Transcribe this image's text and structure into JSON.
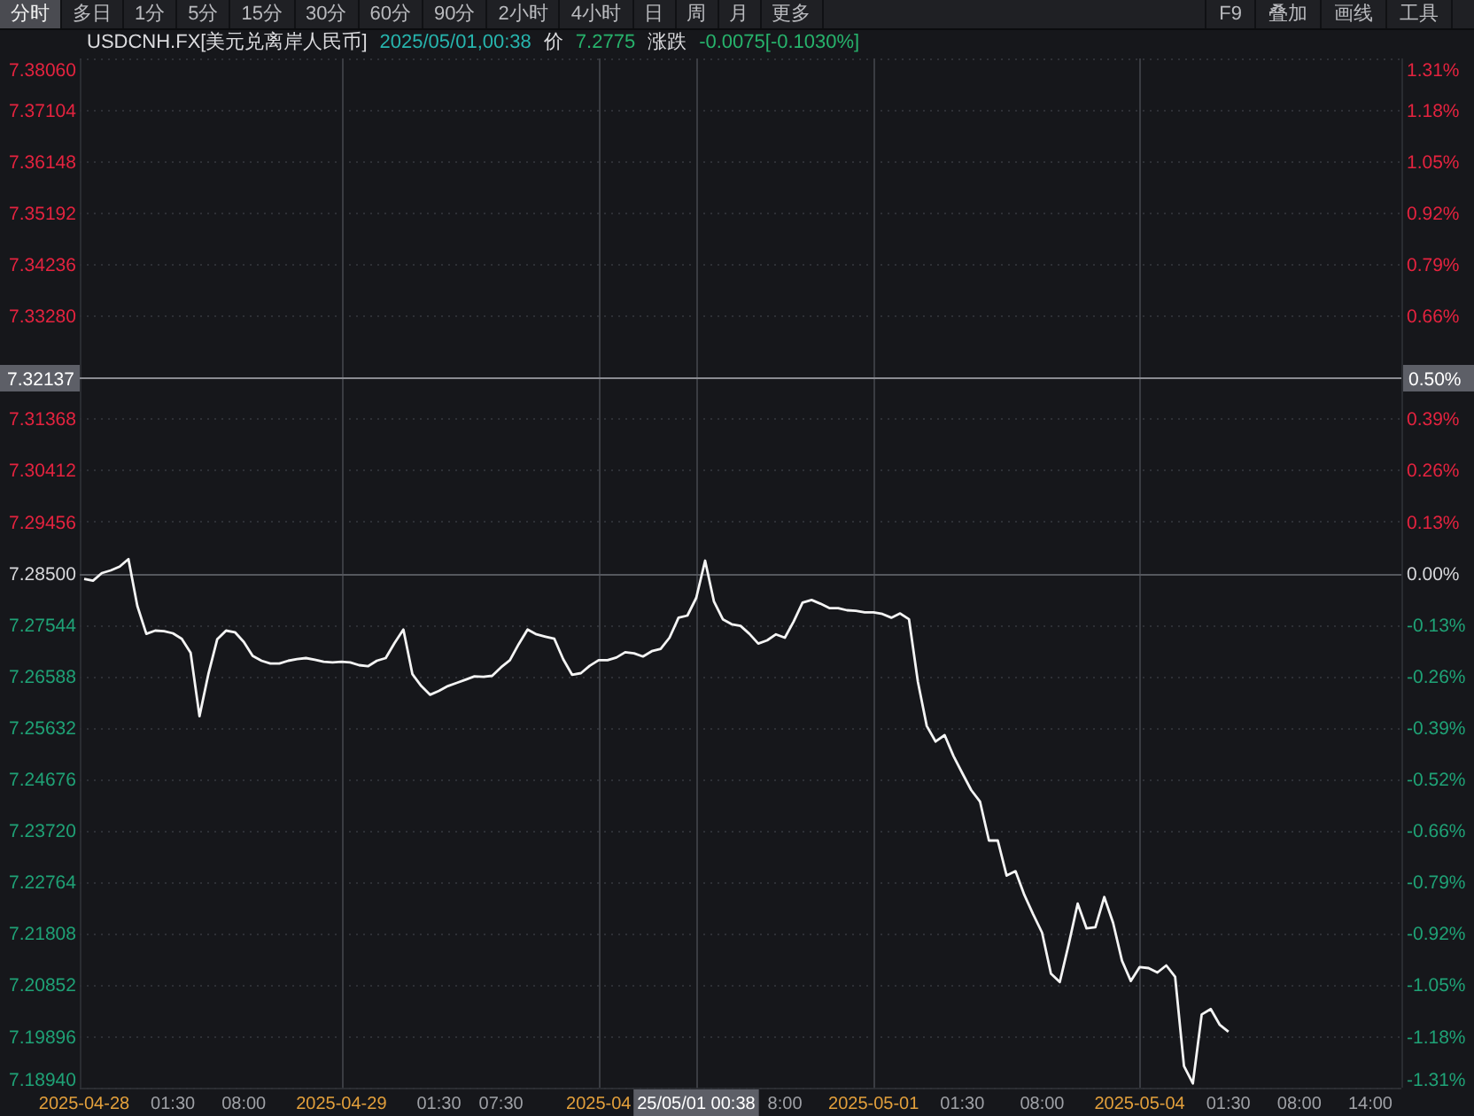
{
  "toolbar": {
    "tabs": [
      {
        "label": "分时",
        "selected": true
      },
      {
        "label": "多日",
        "selected": false
      },
      {
        "label": "1分",
        "selected": false
      },
      {
        "label": "5分",
        "selected": false
      },
      {
        "label": "15分",
        "selected": false
      },
      {
        "label": "30分",
        "selected": false
      },
      {
        "label": "60分",
        "selected": false
      },
      {
        "label": "90分",
        "selected": false
      },
      {
        "label": "2小时",
        "selected": false
      },
      {
        "label": "4小时",
        "selected": false
      },
      {
        "label": "日",
        "selected": false
      },
      {
        "label": "周",
        "selected": false
      },
      {
        "label": "月",
        "selected": false
      },
      {
        "label": "更多",
        "selected": false
      }
    ],
    "actions": [
      "F9",
      "叠加",
      "画线",
      "工具"
    ]
  },
  "quote": {
    "symbol": "USDCNH.FX[美元兑离岸人民币]",
    "time": "2025/05/01,00:38",
    "price_caption": "价",
    "price": "7.2775",
    "change_caption": "涨跌",
    "change": "-0.0075[-0.1030%]",
    "down": true
  },
  "chart": {
    "chart_data": {
      "type": "line",
      "categories": [
        "2025-04-28",
        null,
        null,
        null,
        null,
        null,
        null,
        null,
        null,
        null,
        "01:30",
        null,
        null,
        null,
        null,
        null,
        null,
        null,
        "08:00",
        null,
        null,
        null,
        null,
        null,
        null,
        null,
        null,
        null,
        null,
        "2025-04-29",
        null,
        null,
        null,
        null,
        null,
        null,
        null,
        null,
        null,
        null,
        "01:30",
        null,
        null,
        null,
        null,
        null,
        null,
        "07:30",
        null,
        null,
        null,
        null,
        null,
        null,
        null,
        null,
        null,
        null,
        "2025-04",
        null,
        null,
        null,
        null,
        null,
        null,
        null,
        null,
        null,
        null,
        "25/05/01 00:38",
        null,
        null,
        null,
        null,
        null,
        null,
        null,
        null,
        null,
        "8:00",
        null,
        null,
        null,
        null,
        null,
        null,
        null,
        null,
        null,
        "2025-05-01",
        null,
        null,
        null,
        null,
        null,
        null,
        null,
        null,
        null,
        "01:30",
        null,
        null,
        null,
        null,
        null,
        null,
        null,
        null,
        "08:00",
        null,
        null,
        null,
        null,
        null,
        null,
        null,
        null,
        null,
        null,
        "2025-05-04",
        null,
        null,
        null,
        null,
        null,
        null,
        null,
        null,
        null,
        "01:30",
        null,
        null,
        null,
        null,
        null,
        null,
        null,
        "08:00",
        null,
        null,
        null,
        null,
        null,
        null,
        null,
        "14:00",
        null,
        null,
        null
      ],
      "values": [
        7.2839,
        7.2836,
        7.285,
        7.2855,
        7.2862,
        7.2876,
        7.2789,
        7.2737,
        7.2743,
        7.2742,
        7.2738,
        7.2728,
        7.2702,
        7.2584,
        7.2662,
        7.2727,
        7.2743,
        7.274,
        7.2722,
        7.2696,
        7.2687,
        7.2682,
        7.2682,
        7.2687,
        7.269,
        7.2692,
        7.2689,
        7.2685,
        7.2684,
        7.2685,
        7.2684,
        7.2679,
        7.2677,
        7.2687,
        7.2692,
        7.272,
        7.2745,
        7.2662,
        7.264,
        7.2624,
        7.2631,
        7.264,
        7.2646,
        7.2652,
        7.2658,
        7.2657,
        7.2659,
        7.2675,
        7.2688,
        7.2718,
        7.2745,
        7.2736,
        7.2732,
        7.2728,
        7.269,
        7.2661,
        7.2664,
        7.2678,
        7.2688,
        7.2688,
        7.2693,
        7.2703,
        7.2701,
        7.2695,
        7.2705,
        7.2709,
        7.273,
        7.2767,
        7.2771,
        7.2804,
        7.2873,
        7.2797,
        7.2764,
        7.2755,
        7.2752,
        7.2737,
        7.2719,
        7.2725,
        7.2736,
        7.273,
        7.276,
        7.2795,
        7.28,
        7.2793,
        7.2785,
        7.2785,
        7.2781,
        7.278,
        7.2777,
        7.2777,
        7.2774,
        7.2767,
        7.2775,
        7.2764,
        7.2648,
        7.2566,
        7.2537,
        7.2549,
        7.251,
        7.2478,
        7.2447,
        7.2425,
        7.2353,
        7.2353,
        7.2288,
        7.2296,
        7.2252,
        7.2216,
        7.2182,
        7.2106,
        7.209,
        7.216,
        7.2236,
        7.219,
        7.2192,
        7.2248,
        7.22,
        7.213,
        7.2092,
        7.2118,
        7.2116,
        7.2108,
        7.2121,
        7.21,
        7.1934,
        7.1902,
        7.203,
        7.204,
        7.2011,
        7.1998,
        null,
        null,
        null,
        null,
        null,
        null,
        null,
        null,
        null,
        null,
        null,
        null,
        null,
        null,
        null,
        null,
        null,
        null,
        null
      ],
      "ylim": [
        7.1894,
        7.3806
      ],
      "yticks": [
        {
          "value": 7.3806,
          "label": "7.38060"
        },
        {
          "value": 7.37104,
          "label": "7.37104"
        },
        {
          "value": 7.36148,
          "label": "7.36148"
        },
        {
          "value": 7.35192,
          "label": "7.35192"
        },
        {
          "value": 7.34236,
          "label": "7.34236"
        },
        {
          "value": 7.3328,
          "label": "7.33280"
        },
        {
          "value": 7.31368,
          "label": "7.31368"
        },
        {
          "value": 7.30412,
          "label": "7.30412"
        },
        {
          "value": 7.29456,
          "label": "7.29456"
        },
        {
          "value": 7.285,
          "label": "7.28500"
        },
        {
          "value": 7.27544,
          "label": "7.27544"
        },
        {
          "value": 7.26588,
          "label": "7.26588"
        },
        {
          "value": 7.25632,
          "label": "7.25632"
        },
        {
          "value": 7.24676,
          "label": "7.24676"
        },
        {
          "value": 7.2372,
          "label": "7.23720"
        },
        {
          "value": 7.22764,
          "label": "7.22764"
        },
        {
          "value": 7.21808,
          "label": "7.21808"
        },
        {
          "value": 7.20852,
          "label": "7.20852"
        },
        {
          "value": 7.19896,
          "label": "7.19896"
        },
        {
          "value": 7.1894,
          "label": "7.18940"
        }
      ],
      "grid": true,
      "ref_lines": [
        {
          "axis": "y",
          "value": 7.285
        },
        {
          "axis": "y",
          "value": 7.32137,
          "label": "7.32137"
        }
      ]
    },
    "x_labels": [
      {
        "kind": "date"
      },
      {
        "kind": "time"
      },
      {
        "kind": "time"
      },
      {
        "kind": "date"
      },
      {
        "kind": "time"
      },
      {
        "kind": "time"
      },
      {
        "kind": "date"
      },
      {
        "kind": "cursor"
      },
      {
        "kind": "time"
      },
      {
        "kind": "date"
      },
      {
        "kind": "time"
      },
      {
        "kind": "time"
      },
      {
        "kind": "date"
      },
      {
        "kind": "time"
      },
      {
        "kind": "time"
      },
      {
        "kind": "time"
      }
    ],
    "percent_axis": {
      "ticks": [
        "1.31%",
        "1.18%",
        "1.05%",
        "0.92%",
        "0.79%",
        "0.66%",
        "0.39%",
        "0.26%",
        "0.13%",
        "0.00%",
        "-0.13%",
        "-0.26%",
        "-0.39%",
        "-0.52%",
        "-0.66%",
        "-0.79%",
        "-0.92%",
        "-1.05%",
        "-1.18%",
        "-1.31%"
      ],
      "crosshair_label": "0.50%"
    }
  }
}
